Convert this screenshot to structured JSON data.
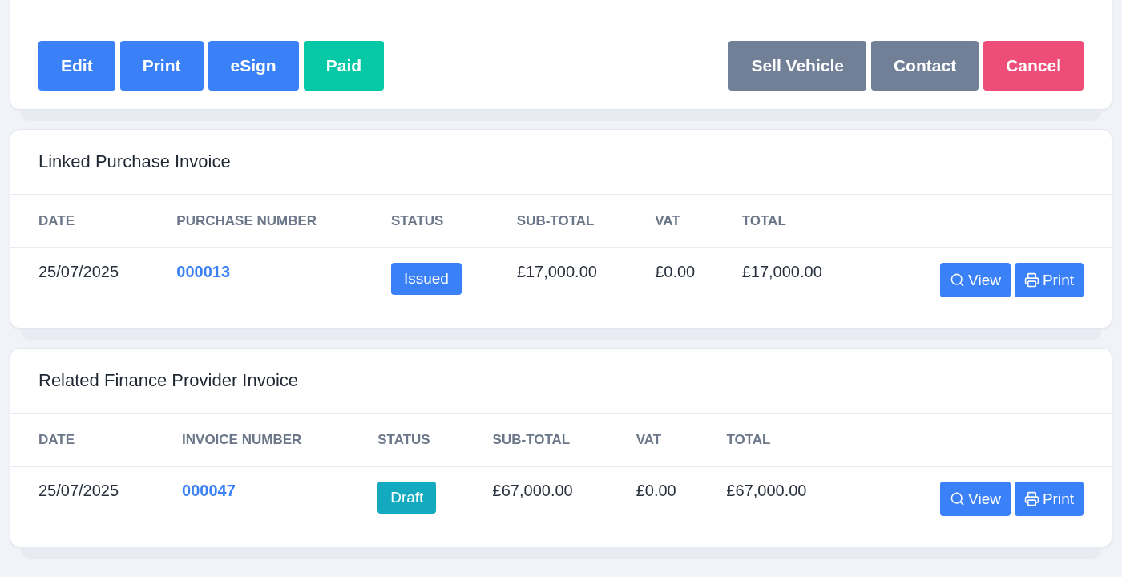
{
  "actions": {
    "left": [
      {
        "label": "Edit",
        "kind": "primary"
      },
      {
        "label": "Print",
        "kind": "primary"
      },
      {
        "label": "eSign",
        "kind": "primary"
      },
      {
        "label": "Paid",
        "kind": "success"
      }
    ],
    "right": [
      {
        "label": "Sell Vehicle",
        "kind": "secondary"
      },
      {
        "label": "Contact",
        "kind": "secondary"
      },
      {
        "label": "Cancel",
        "kind": "danger"
      }
    ]
  },
  "sections": [
    {
      "title": "Linked Purchase Invoice",
      "columns": [
        "DATE",
        "PURCHASE NUMBER",
        "STATUS",
        "SUB-TOTAL",
        "VAT",
        "TOTAL"
      ],
      "rows": [
        {
          "date": "25/07/2025",
          "number": "000013",
          "status": {
            "label": "Issued",
            "kind": "issued"
          },
          "subtotal": "£17,000.00",
          "vat": "£0.00",
          "total": "£17,000.00",
          "view": "View",
          "print": "Print"
        }
      ]
    },
    {
      "title": "Related Finance Provider Invoice",
      "columns": [
        "DATE",
        "INVOICE NUMBER",
        "STATUS",
        "SUB-TOTAL",
        "VAT",
        "TOTAL"
      ],
      "rows": [
        {
          "date": "25/07/2025",
          "number": "000047",
          "status": {
            "label": "Draft",
            "kind": "draft"
          },
          "subtotal": "£67,000.00",
          "vat": "£0.00",
          "total": "£67,000.00",
          "view": "View",
          "print": "Print"
        }
      ]
    }
  ]
}
